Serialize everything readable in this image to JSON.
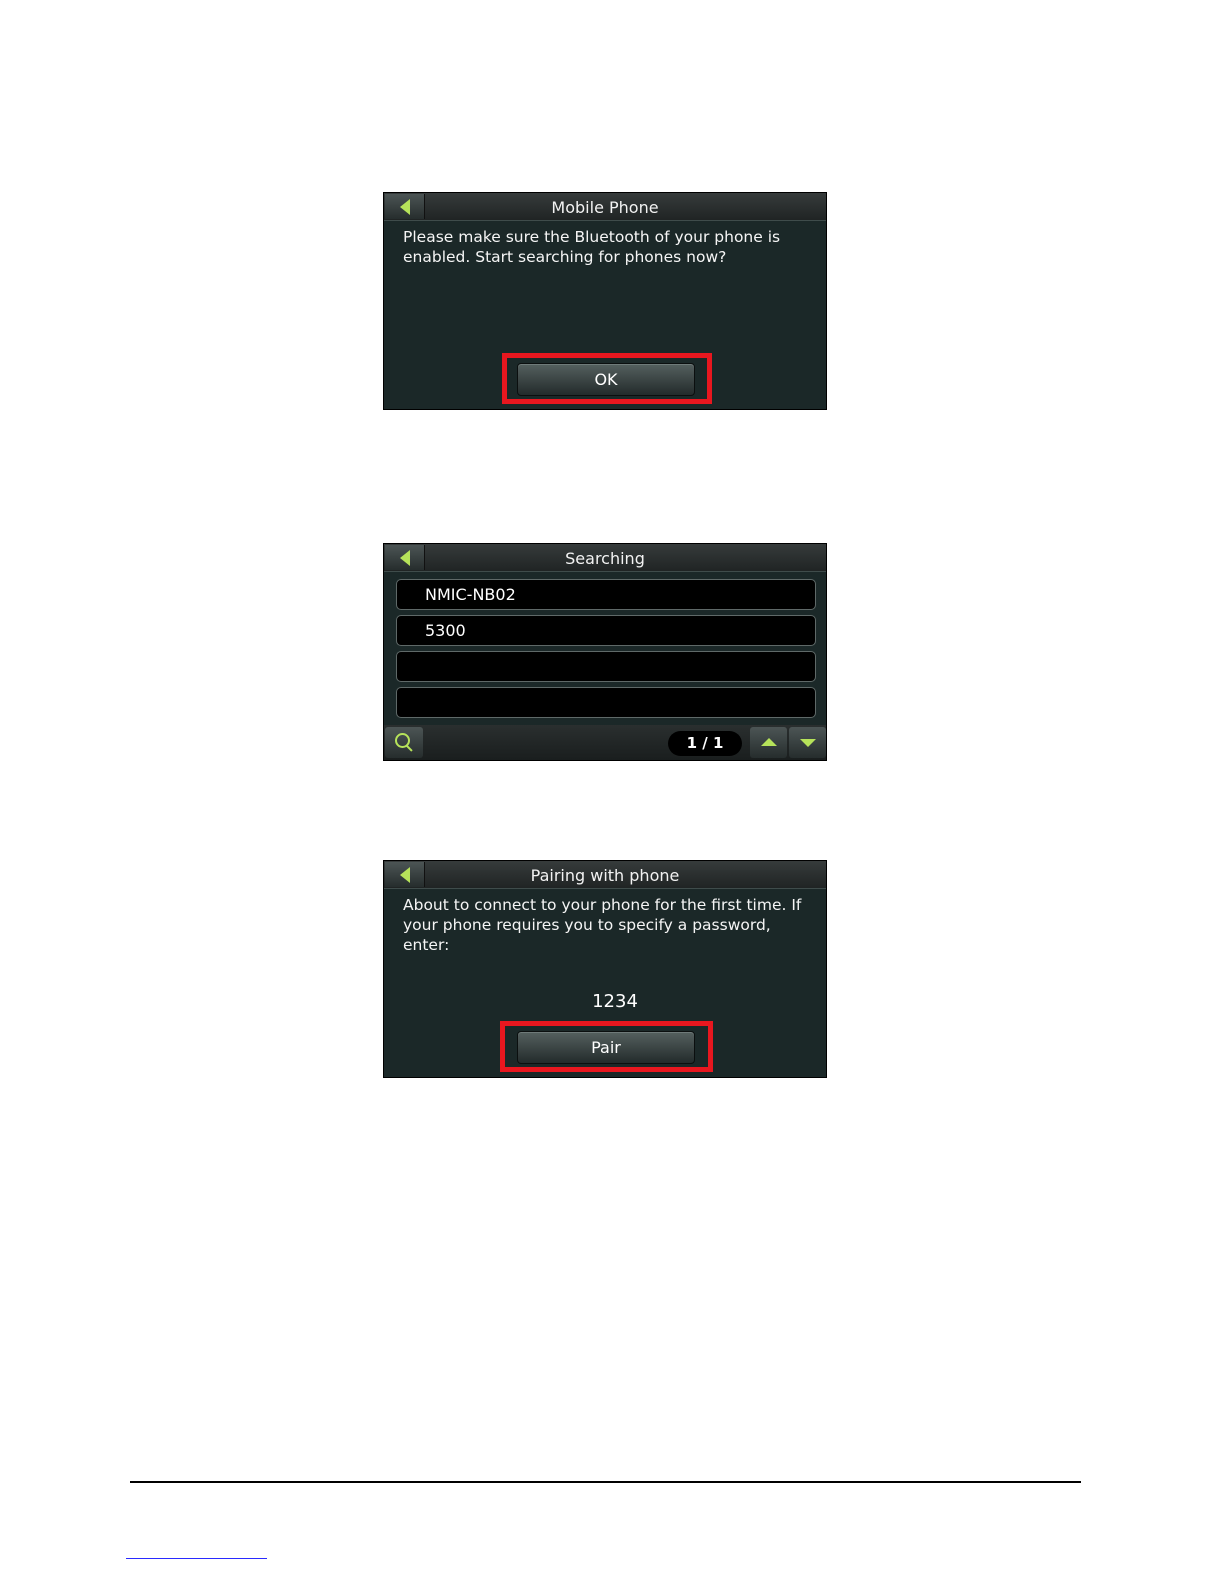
{
  "colors": {
    "accent": "#b6e35a",
    "highlight": "#e8171f",
    "screen_bg": "#1b2828"
  },
  "screen1": {
    "title": "Mobile Phone",
    "back_icon": "back-arrow-icon",
    "message": "Please make sure the Bluetooth of your phone is enabled. Start searching for phones now?",
    "ok_label": "OK"
  },
  "screen2": {
    "title": "Searching",
    "back_icon": "back-arrow-icon",
    "devices": [
      "NMIC-NB02",
      "5300",
      "",
      ""
    ],
    "page_indicator": "1 / 1",
    "search_icon": "search-icon",
    "up_icon": "arrow-up-icon",
    "down_icon": "arrow-down-icon"
  },
  "screen3": {
    "title": "Pairing with phone",
    "back_icon": "back-arrow-icon",
    "message": "About to connect to your phone for the first time. If your phone requires you to specify a password, enter:",
    "code": "1234",
    "pair_label": "Pair"
  }
}
